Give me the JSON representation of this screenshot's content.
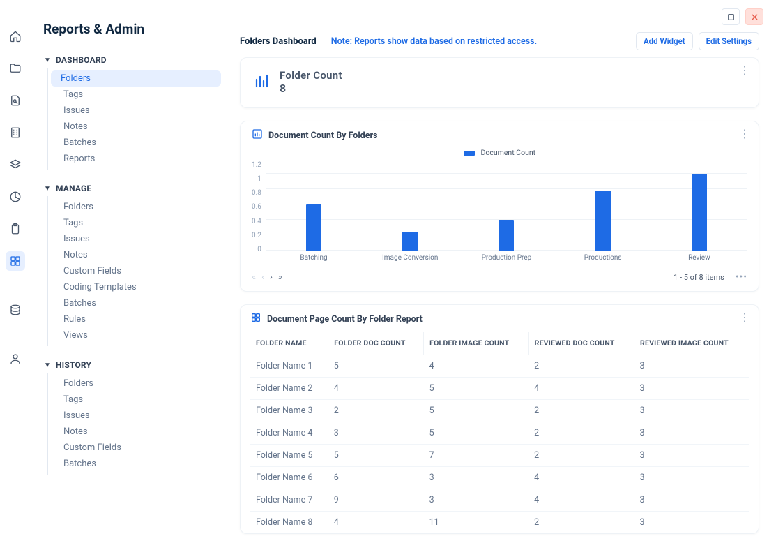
{
  "page": {
    "title": "Reports & Admin"
  },
  "sidebar": {
    "sections": [
      {
        "label": "DASHBOARD",
        "items": [
          "Folders",
          "Tags",
          "Issues",
          "Notes",
          "Batches",
          "Reports"
        ],
        "activeIndex": 0
      },
      {
        "label": "MANAGE",
        "items": [
          "Folders",
          "Tags",
          "Issues",
          "Notes",
          "Custom Fields",
          "Coding Templates",
          "Batches",
          "Rules",
          "Views"
        ],
        "activeIndex": -1
      },
      {
        "label": "HISTORY",
        "items": [
          "Folders",
          "Tags",
          "Issues",
          "Notes",
          "Custom Fields",
          "Batches"
        ],
        "activeIndex": -1
      }
    ]
  },
  "header": {
    "tab_title": "Folders Dashboard",
    "note": "Note: Reports show data based on restricted access.",
    "buttons": {
      "add_widget": "Add Widget",
      "edit_settings": "Edit Settings"
    }
  },
  "count_widget": {
    "title": "Folder Count",
    "value": "8"
  },
  "chart_widget": {
    "title": "Document Count By Folders",
    "legend": "Document Count",
    "pager_info": "1 - 5 of 8 items"
  },
  "chart_data": {
    "type": "bar",
    "title": "Document Count By Folders",
    "xlabel": "",
    "ylabel": "",
    "ylim": [
      0,
      1.2
    ],
    "y_ticks": [
      0,
      0.2,
      0.4,
      0.6,
      0.8,
      1,
      1.2
    ],
    "categories": [
      "Batching",
      "Image Conversion",
      "Production Prep",
      "Productions",
      "Review"
    ],
    "series": [
      {
        "name": "Document Count",
        "values": [
          0.6,
          0.25,
          0.4,
          0.78,
          1.0
        ]
      }
    ]
  },
  "table_widget": {
    "title": "Document Page Count By Folder Report",
    "columns": [
      "FOLDER NAME",
      "FOLDER DOC COUNT",
      "FOLDER IMAGE COUNT",
      "REVIEWED DOC COUNT",
      "REVIEWED IMAGE COUNT"
    ],
    "rows": [
      [
        "Folder Name 1",
        "5",
        "4",
        "2",
        "3"
      ],
      [
        "Folder Name 2",
        "4",
        "5",
        "4",
        "3"
      ],
      [
        "Folder Name 3",
        "2",
        "5",
        "2",
        "3"
      ],
      [
        "Folder Name 4",
        "3",
        "5",
        "2",
        "3"
      ],
      [
        "Folder Name 5",
        "5",
        "7",
        "2",
        "3"
      ],
      [
        "Folder Name 6",
        "6",
        "3",
        "4",
        "3"
      ],
      [
        "Folder Name 7",
        "9",
        "3",
        "4",
        "3"
      ],
      [
        "Folder Name 8",
        "4",
        "11",
        "2",
        "3"
      ]
    ]
  },
  "rail_icons": [
    "home",
    "folder",
    "search-doc",
    "building",
    "layers",
    "pie",
    "clipboard",
    "dashboard",
    "database",
    "profile"
  ],
  "rail_active_index": 7
}
